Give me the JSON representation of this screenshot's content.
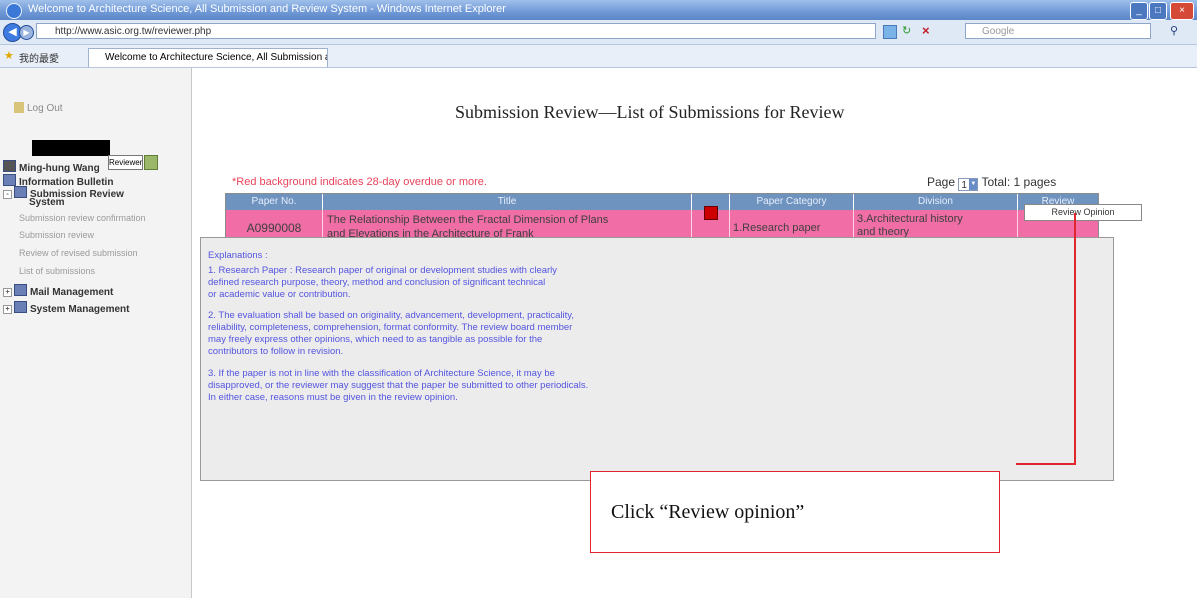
{
  "window": {
    "title": "Welcome to Architecture Science, All Submission and Review System - Windows Internet Explorer",
    "controls": [
      "_",
      "□",
      "×"
    ]
  },
  "browser": {
    "address": "http://www.asic.org.tw/reviewer.php",
    "search_placeholder": "Google",
    "favorites_label": "我的最愛",
    "tab_title": "Welcome to Architecture Science, All Submission and"
  },
  "sidebar": {
    "logout": "Log Out",
    "user_name": "Ming-hung Wang",
    "role": "Reviewer",
    "items": [
      {
        "label": "Information Bulletin",
        "type": "section"
      },
      {
        "label": "Submission Review",
        "type": "section"
      },
      {
        "label": "System",
        "type": "section-cont"
      },
      {
        "label": "Submission review confirmation",
        "type": "sub"
      },
      {
        "label": "Submission review",
        "type": "sub"
      },
      {
        "label": "Review of revised submission",
        "type": "sub"
      },
      {
        "label": "List of submissions",
        "type": "sub"
      },
      {
        "label": "Mail Management",
        "type": "section"
      },
      {
        "label": "System Management",
        "type": "section"
      }
    ]
  },
  "main": {
    "page_title": "Submission Review—List of Submissions for Review",
    "overdue_note": "*Red background indicates 28-day overdue or more.",
    "page_label": "Page",
    "page_value": "1",
    "total_label": "Total: 1 pages",
    "table": {
      "headers": [
        "Paper No.",
        "Title",
        "",
        "Paper Category",
        "Division",
        "Review"
      ],
      "row": {
        "paper_no": "A0990008",
        "title_line1": "The Relationship Between the Fractal Dimension of Plans",
        "title_line2": "and Elevations in the Architecture of Frank",
        "category": "1.Research paper",
        "division_line1": "3.Architectural history",
        "division_line2": "and theory",
        "review_button": "Review Opinion"
      }
    },
    "explanations": {
      "heading": "Explanations :",
      "lines": [
        "1. Research Paper : Research paper of original or development studies with clearly",
        "   defined research purpose, theory, method and conclusion of significant technical",
        "   or academic value or contribution.",
        "",
        "2. The evaluation shall be based on originality, advancement, development, practicality,",
        "   reliability, completeness, comprehension, format conformity. The review board member",
        "   may freely express other opinions, which need to as tangible as possible for the",
        "   contributors to follow in revision.",
        "",
        "3. If the paper is not in line with the classification of Architecture Science, it may be",
        "   disapproved, or the reviewer may suggest that the paper be submitted to other periodicals.",
        "   In either case, reasons must be given in the review opinion."
      ]
    }
  },
  "callout": {
    "text": "Click “Review opinion”"
  },
  "colors": {
    "header_blue": "#6f93bf",
    "overdue_pink": "#f06da6",
    "explanation_text": "#5454e0",
    "callout_red": "#e0262e"
  }
}
